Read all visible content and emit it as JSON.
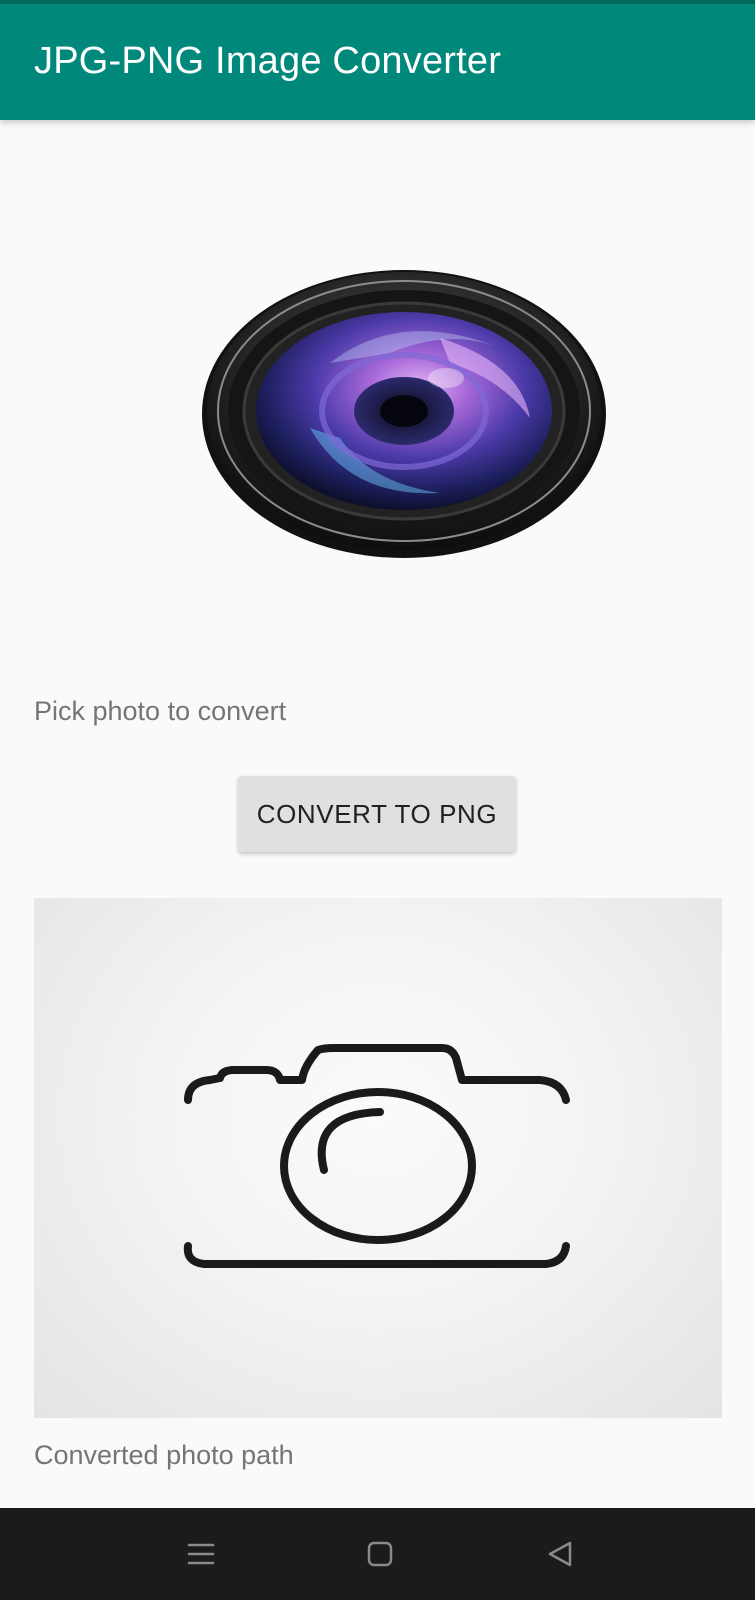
{
  "app_bar": {
    "title": "JPG-PNG Image Converter",
    "color": "#00897b"
  },
  "main": {
    "pick_label": "Pick photo to convert",
    "convert_button_label": "CONVERT TO PNG",
    "result_label": "Converted photo path",
    "lens_image_icon": "camera-lens-icon",
    "preview_image_icon": "camera-outline-icon"
  },
  "nav_bar": {
    "items": [
      {
        "icon": "menu-icon"
      },
      {
        "icon": "home-square-icon"
      },
      {
        "icon": "back-triangle-icon"
      }
    ]
  }
}
